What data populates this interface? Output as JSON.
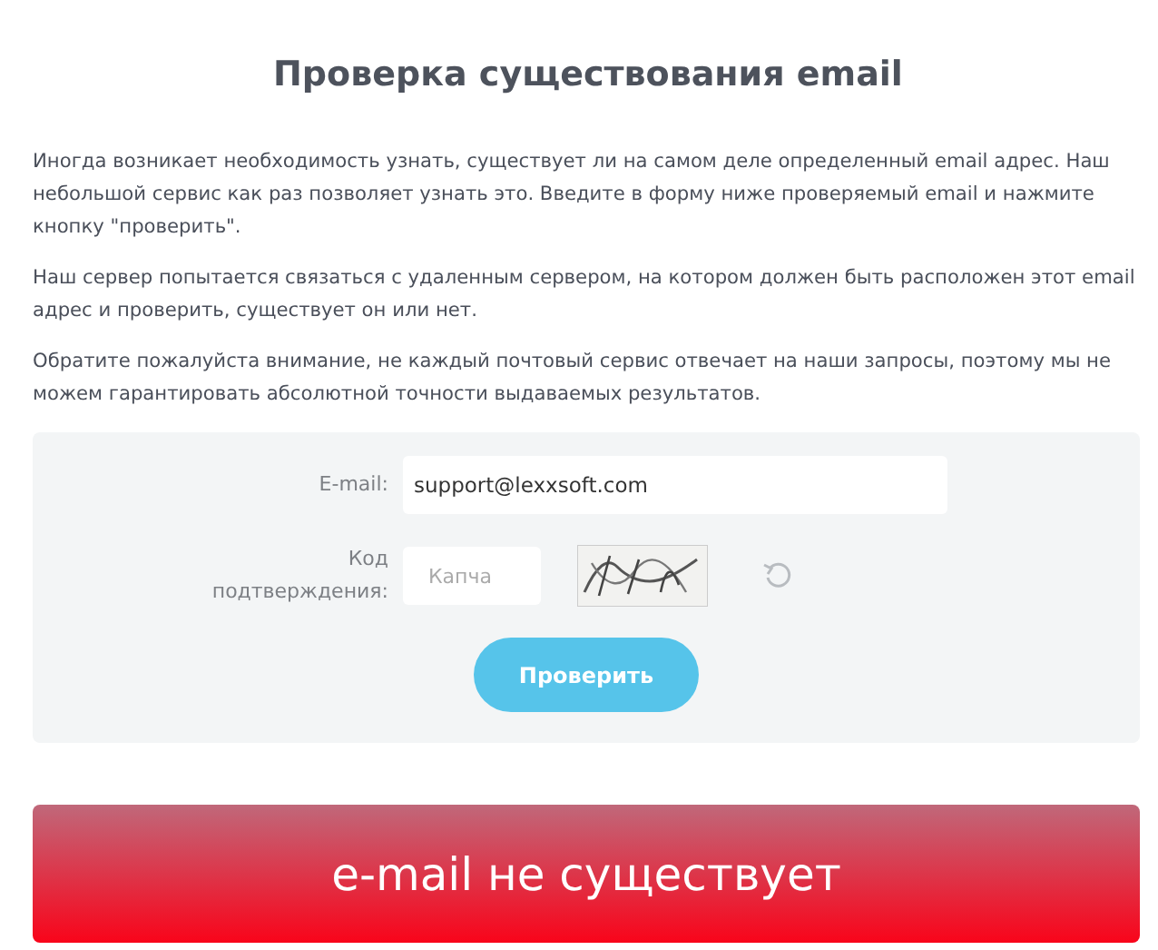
{
  "title": "Проверка существования email",
  "paragraphs": [
    "Иногда возникает необходимость узнать, существует ли на самом деле определенный email адрес. Наш небольшой сервис как раз позволяет узнать это. Введите в форму ниже проверяемый email и нажмите кнопку \"проверить\".",
    "Наш сервер попытается связаться с удаленным сервером, на котором должен быть расположен этот email адрес и проверить, существует он или нет.",
    "Обратите пожалуйста внимание, не каждый почтовый сервис отвечает на наши запросы, поэтому мы не можем гарантировать абсолютной точности выдаваемых результатов."
  ],
  "form": {
    "email_label": "E-mail:",
    "email_value": "support@lexxsoft.com",
    "code_label": "Код подтверждения:",
    "code_placeholder": "Капча",
    "submit": "Проверить"
  },
  "result": {
    "text": "e-mail не существует",
    "exists": false
  }
}
